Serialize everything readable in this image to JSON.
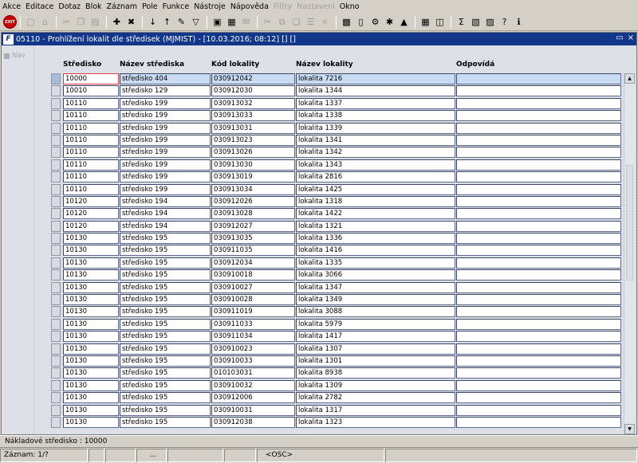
{
  "menu": [
    {
      "label": "Akce",
      "enabled": true
    },
    {
      "label": "Editace",
      "enabled": true
    },
    {
      "label": "Dotaz",
      "enabled": true
    },
    {
      "label": "Blok",
      "enabled": true
    },
    {
      "label": "Záznam",
      "enabled": true
    },
    {
      "label": "Pole",
      "enabled": true
    },
    {
      "label": "Funkce",
      "enabled": true
    },
    {
      "label": "Nástroje",
      "enabled": true
    },
    {
      "label": "Nápověda",
      "enabled": true
    },
    {
      "label": "Filtry",
      "enabled": false
    },
    {
      "label": "Nastavení",
      "enabled": false
    },
    {
      "label": "Okno",
      "enabled": true
    }
  ],
  "toolbar": {
    "exit_label": "EXIT",
    "icons": [
      "save-icon",
      "print-icon",
      "cut-icon",
      "copy-icon",
      "paste-icon",
      "insert-record-icon",
      "delete-record-icon",
      "sort-asc-icon",
      "sort-desc-icon",
      "flashlight-icon",
      "filter-icon",
      "printer-icon",
      "report-icon",
      "mail-icon",
      "scissors-icon",
      "clone-icon",
      "duplicate-icon",
      "list-icon",
      "tree-icon",
      "calendar-icon",
      "document-icon",
      "gear-icon",
      "star-icon",
      "warning-icon",
      "grid-icon",
      "preview-icon",
      "sum-icon",
      "excel-icon",
      "word-icon",
      "help-icon",
      "info-icon"
    ]
  },
  "window": {
    "title": "05110 - Prohlížení lokalit dle středisek (MJMIST) - [10.03.2016; 08:12] [] []",
    "restore_glyph": "▭",
    "close_glyph": "×",
    "app_icon_letter": "F"
  },
  "nav": {
    "label": "Nav"
  },
  "table": {
    "columns": [
      "Středisko",
      "Název střediska",
      "Kód lokality",
      "Název lokality",
      "Odpovídá"
    ],
    "rows": [
      [
        "10000",
        "středisko 404",
        "030912042",
        "lokalita 7216",
        ""
      ],
      [
        "10010",
        "středisko 129",
        "030912030",
        "lokalita 1344",
        ""
      ],
      [
        "10110",
        "středisko 199",
        "030913032",
        "lokalita 1337",
        ""
      ],
      [
        "10110",
        "středisko 199",
        "030913033",
        "lokalita 1338",
        ""
      ],
      [
        "10110",
        "středisko 199",
        "030913031",
        "lokalita 1339",
        ""
      ],
      [
        "10110",
        "středisko 199",
        "030913023",
        "lokalita 1341",
        ""
      ],
      [
        "10110",
        "středisko 199",
        "030913026",
        "lokalita 1342",
        ""
      ],
      [
        "10110",
        "středisko 199",
        "030913030",
        "lokalita 1343",
        ""
      ],
      [
        "10110",
        "středisko 199",
        "030913019",
        "lokalita 2816",
        ""
      ],
      [
        "10110",
        "středisko 199",
        "030913034",
        "lokalita 1425",
        ""
      ],
      [
        "10120",
        "středisko 194",
        "030912026",
        "lokalita 1318",
        ""
      ],
      [
        "10120",
        "středisko 194",
        "030913028",
        "lokalita 1422",
        ""
      ],
      [
        "10120",
        "středisko 194",
        "030912027",
        "lokalita 1321",
        ""
      ],
      [
        "10130",
        "středisko 195",
        "030913035",
        "lokalita 1336",
        ""
      ],
      [
        "10130",
        "středisko 195",
        "030911035",
        "lokalita 1416",
        ""
      ],
      [
        "10130",
        "středisko 195",
        "030912034",
        "lokalita 1335",
        ""
      ],
      [
        "10130",
        "středisko 195",
        "030910018",
        "lokalita 3066",
        ""
      ],
      [
        "10130",
        "středisko 195",
        "030910027",
        "lokalita 1347",
        ""
      ],
      [
        "10130",
        "středisko 195",
        "030910028",
        "lokalita 1349",
        ""
      ],
      [
        "10130",
        "středisko 195",
        "030911019",
        "lokalita 3088",
        ""
      ],
      [
        "10130",
        "středisko 195",
        "030911033",
        "lokalita 5979",
        ""
      ],
      [
        "10130",
        "středisko 195",
        "030911034",
        "lokalita 1417",
        ""
      ],
      [
        "10130",
        "středisko 195",
        "030910023",
        "lokalita 1307",
        ""
      ],
      [
        "10130",
        "středisko 195",
        "030910033",
        "lokalita 1301",
        ""
      ],
      [
        "10130",
        "středisko 195",
        "010103031",
        "lokalita 8938",
        ""
      ],
      [
        "10130",
        "středisko 195",
        "030910032",
        "lokalita 1309",
        ""
      ],
      [
        "10130",
        "středisko 195",
        "030912006",
        "lokalita 2782",
        ""
      ],
      [
        "10130",
        "středisko 195",
        "030910031",
        "lokalita 1317",
        ""
      ],
      [
        "10130",
        "středisko 195",
        "030912038",
        "lokalita 1323",
        ""
      ]
    ]
  },
  "hint": "Nákladové středisko : 10000",
  "status": {
    "record": "Záznam: 1/?",
    "ellipsis": "...",
    "mode": "<OSC>"
  }
}
